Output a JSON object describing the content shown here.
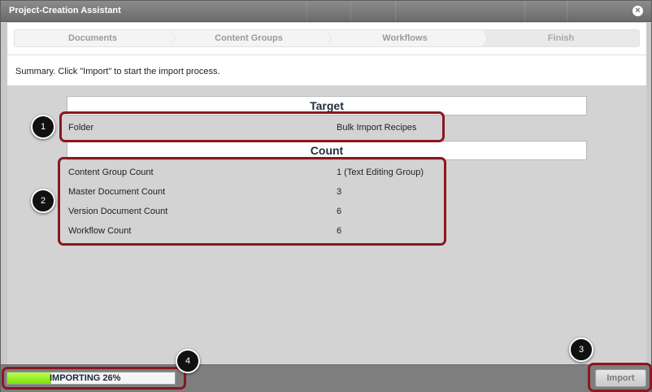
{
  "window": {
    "title": "Project-Creation Assistant",
    "close_symbol": "×"
  },
  "steps": [
    {
      "label": "Documents"
    },
    {
      "label": "Content Groups"
    },
    {
      "label": "Workflows"
    },
    {
      "label": "Finish"
    }
  ],
  "summary": {
    "text": "Summary. Click \"Import\" to start the import process."
  },
  "target": {
    "heading": "Target",
    "rows": [
      {
        "key": "Folder",
        "value": "Bulk Import Recipes"
      }
    ]
  },
  "count": {
    "heading": "Count",
    "rows": [
      {
        "key": "Content Group Count",
        "value": "1 (Text Editing Group)"
      },
      {
        "key": "Master Document Count",
        "value": "3"
      },
      {
        "key": "Version Document Count",
        "value": "6"
      },
      {
        "key": "Workflow Count",
        "value": "6"
      }
    ]
  },
  "progress": {
    "label": "IMPORTING 26%",
    "percent": 26,
    "fill_color": "#8de81c"
  },
  "import_button": {
    "label": "Import"
  },
  "callouts": [
    "1",
    "2",
    "3",
    "4"
  ],
  "colors": {
    "highlight": "#8b1720",
    "badge": "#111111"
  }
}
